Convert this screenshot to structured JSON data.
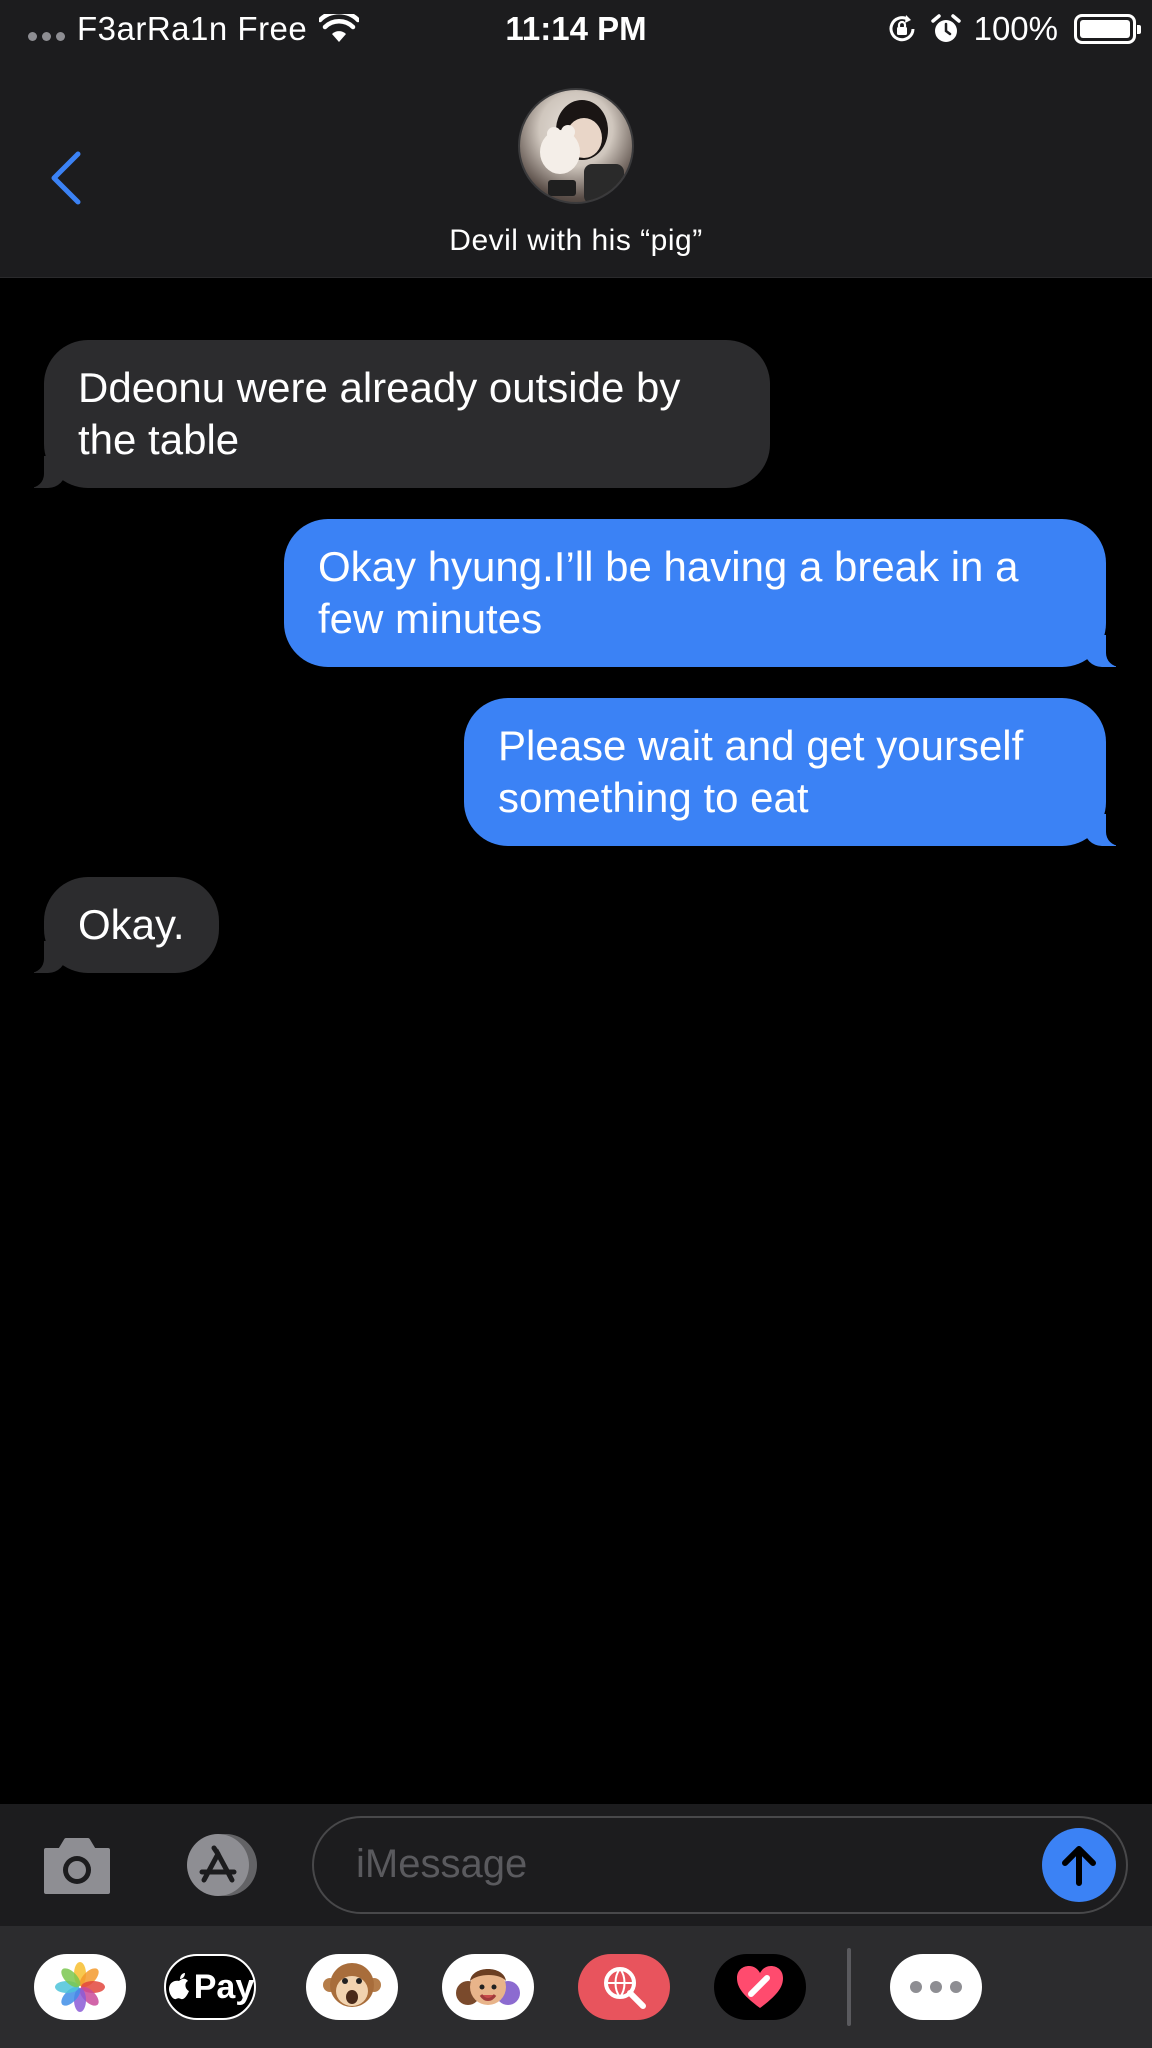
{
  "status_bar": {
    "carrier": "F3arRa1n Free",
    "time": "11:14 PM",
    "battery_percent": "100%",
    "battery_level": 1.0
  },
  "nav": {
    "contact_name": "Devil with his “pig”",
    "back_icon": "chevron-left-icon"
  },
  "messages": [
    {
      "direction": "incoming",
      "text": "Ddeonu were already outside by the table"
    },
    {
      "direction": "outgoing",
      "text": "Okay hyung.I’ll be having a break in a few minutes"
    },
    {
      "direction": "outgoing",
      "text": "Please wait and get yourself something to eat"
    },
    {
      "direction": "incoming",
      "text": "Okay."
    }
  ],
  "input": {
    "placeholder": "iMessage",
    "camera_icon": "camera-icon",
    "apps_icon": "app-store-icon",
    "send_icon": "arrow-up-icon"
  },
  "app_drawer": {
    "apple_pay_label": "Pay",
    "apps": [
      "photos-icon",
      "apple-pay-icon",
      "animoji-icon",
      "memoji-icon",
      "image-search-icon",
      "digital-touch-icon",
      "more-icon"
    ]
  },
  "colors": {
    "accent": "#3b82f5",
    "incoming_bubble": "#2c2c2e",
    "bar_background": "#1c1c1e",
    "drawer_background": "#2c2c2e"
  }
}
